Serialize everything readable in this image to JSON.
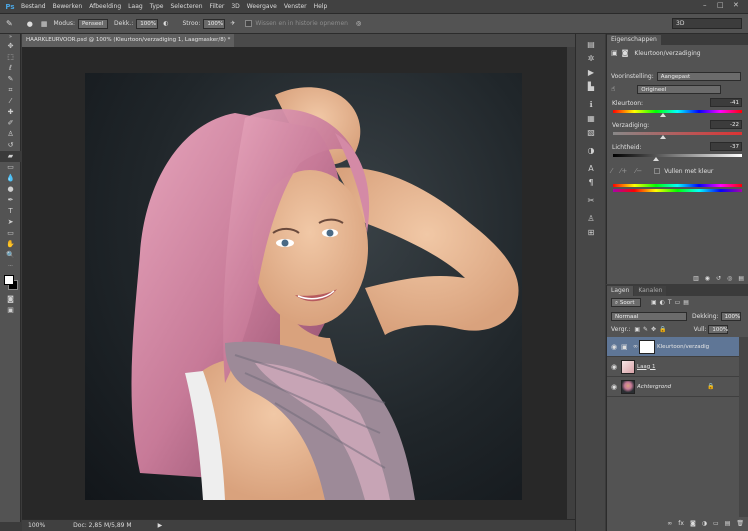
{
  "app": {
    "logo": "Ps"
  },
  "menubar": {
    "items": [
      "Bestand",
      "Bewerken",
      "Afbeelding",
      "Laag",
      "Type",
      "Selecteren",
      "Filter",
      "3D",
      "Weergave",
      "Venster",
      "Help"
    ],
    "window_controls": [
      "–",
      "□",
      "✕"
    ]
  },
  "options": {
    "mode_label": "Modus:",
    "mode_value": "Penseel",
    "opacity_label": "Dekk.:",
    "opacity_value": "100%",
    "flow_label": "Stroo:",
    "flow_value": "100%",
    "history_label": "Wissen en in historie opnemen",
    "workspace": "3D"
  },
  "document": {
    "tab_title": "HAARKLEURVOOR.psd @ 100% (Kleurtoon/verzadiging 1, Laagmasker/8) *",
    "tab_close": "×"
  },
  "status": {
    "zoom": "100%",
    "doc_info": "Doc: 2,85 M/5,89 M"
  },
  "properties": {
    "tab": "Eigenschappen",
    "header": "Kleurtoon/verzadiging",
    "preset_label": "Voorinstelling:",
    "preset_value": "Aangepast",
    "channel_value": "Origineel",
    "hue_label": "Kleurtoon:",
    "hue_value": "-41",
    "hue_fraction": 0.39,
    "saturation_label": "Verzadiging:",
    "saturation_value": "-22",
    "saturation_fraction": 0.39,
    "lightness_label": "Lichtheid:",
    "lightness_value": "-37",
    "lightness_fraction": 0.33,
    "colorize_label": "Vullen met kleur"
  },
  "layers_panel": {
    "tabs": [
      "Lagen",
      "Kanalen"
    ],
    "filter_label": "Soort",
    "blend_mode": "Normaal",
    "opacity_label": "Dekking:",
    "opacity_value": "100%",
    "lock_label": "Vergr.:",
    "fill_label": "Vull:",
    "fill_value": "100%",
    "layers": [
      {
        "name": "Kleurtoon/verzadiging...",
        "selected": true
      },
      {
        "name": "Laag 1",
        "selected": false
      },
      {
        "name": "Achtergrond",
        "selected": false
      }
    ]
  },
  "colors": {
    "accent": "#5f7696",
    "hair": "#c77a98",
    "skin": "#e7b894"
  }
}
